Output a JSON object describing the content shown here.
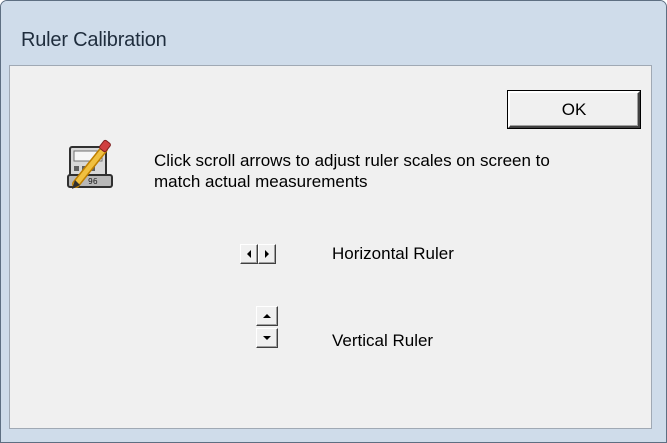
{
  "window": {
    "title": "Ruler Calibration"
  },
  "dialog": {
    "ok_label": "OK",
    "icon": "pencil-ruler-icon",
    "instruction": "Click scroll arrows to adjust ruler scales on screen to match actual measurements"
  },
  "horizontal": {
    "label": "Horizontal Ruler",
    "left_icon": "arrow-left-icon",
    "right_icon": "arrow-right-icon"
  },
  "vertical": {
    "label": "Vertical Ruler",
    "up_icon": "arrow-up-icon",
    "down_icon": "arrow-down-icon"
  },
  "colors": {
    "frame": "#cfdcea",
    "client": "#f0f0f0",
    "text": "#000000"
  }
}
